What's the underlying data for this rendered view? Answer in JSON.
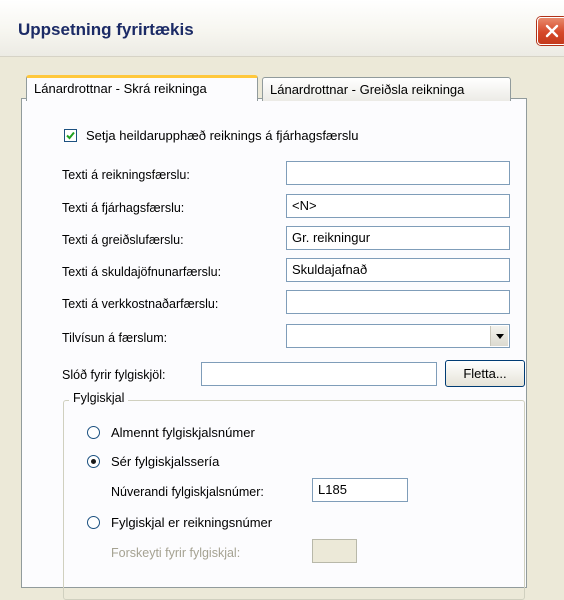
{
  "window": {
    "title": "Uppsetning fyrirtækis"
  },
  "tabs": [
    {
      "label": "Lánardrottnar - Skrá reikninga",
      "active": true
    },
    {
      "label": "Lánardrottnar - Greiðsla reikninga",
      "active": false
    }
  ],
  "checkbox": {
    "label": "Setja heildarupphæð reiknings á fjárhagsfærslu",
    "checked": true
  },
  "fields": [
    {
      "label": "Texti á reikningsfærslu:",
      "value": ""
    },
    {
      "label": "Texti á fjárhagsfærslu:",
      "value": "<N>"
    },
    {
      "label": "Texti á greiðslufærslu:",
      "value": "Gr. reikningur"
    },
    {
      "label": "Texti á skuldajöfnunarfærslu:",
      "value": "Skuldajafnað"
    },
    {
      "label": "Texti á verkkostnaðarfærslu:",
      "value": ""
    }
  ],
  "reference": {
    "label": "Tilvísun á færslum:",
    "value": ""
  },
  "attachments_path": {
    "label": "Slóð fyrir fylgiskjöl:",
    "value": "",
    "button_label": "Fletta..."
  },
  "group": {
    "title": "Fylgiskjal",
    "options": [
      {
        "label": "Almennt fylgiskjalsnúmer",
        "selected": false
      },
      {
        "label": "Sér fylgiskjalssería",
        "selected": true
      },
      {
        "label": "Fylgiskjal er reikningsnúmer",
        "selected": false
      }
    ],
    "current_number": {
      "label": "Núverandi fylgiskjalsnúmer:",
      "value": "L185"
    },
    "prefix": {
      "label": "Forskeyti fyrir fylgiskjal:",
      "value": ""
    }
  },
  "colors": {
    "tab_highlight": "#ffc83c",
    "title_text": "#1c2b66",
    "close_button": "#d6492a"
  }
}
